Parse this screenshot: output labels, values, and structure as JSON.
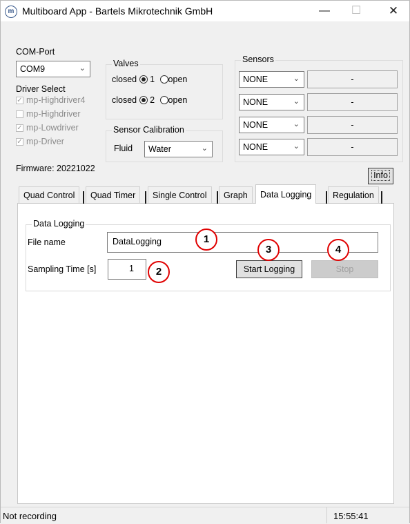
{
  "window": {
    "title": "Multiboard App - Bartels Mikrotechnik GmbH",
    "icon_letter": "m"
  },
  "titlebar": {
    "minimize": "—",
    "maximize": "☐",
    "close": "✕"
  },
  "com_port": {
    "label": "COM-Port",
    "value": "COM9"
  },
  "driver_select": {
    "label": "Driver Select",
    "items": [
      {
        "label": "mp-Highdriver4",
        "checked": true
      },
      {
        "label": "mp-Highdriver",
        "checked": false
      },
      {
        "label": "mp-Lowdriver",
        "checked": true
      },
      {
        "label": "mp-Driver",
        "checked": true
      }
    ]
  },
  "valves": {
    "label": "Valves",
    "rows": [
      {
        "closed": "closed",
        "number": "1",
        "open": "open"
      },
      {
        "closed": "closed",
        "number": "2",
        "open": "open"
      }
    ]
  },
  "sensor_calibration": {
    "label": "Sensor Calibration",
    "fluid_label": "Fluid",
    "fluid_value": "Water"
  },
  "sensors": {
    "label": "Sensors",
    "rows": [
      {
        "type": "NONE",
        "value": "-"
      },
      {
        "type": "NONE",
        "value": "-"
      },
      {
        "type": "NONE",
        "value": "-"
      },
      {
        "type": "NONE",
        "value": "-"
      }
    ]
  },
  "firmware": "Firmware: 20221022",
  "info_button": "Info",
  "tabs": [
    "Quad Control",
    "Quad Timer",
    "Single Control",
    "Graph",
    "Data Logging",
    "Regulation"
  ],
  "data_logging": {
    "group_label": "Data Logging",
    "file_name_label": "File name",
    "file_name_value": "DataLogging",
    "sampling_label": "Sampling Time [s]",
    "sampling_value": "1",
    "start_button": "Start Logging",
    "stop_button": "Stop"
  },
  "annotations": [
    "1",
    "2",
    "3",
    "4"
  ],
  "status": {
    "text": "Not recording",
    "time": "15:55:41"
  },
  "colors": {
    "annotation": "#e00000",
    "window_bg": "#f0f0f0",
    "panel_bg": "#ffffff"
  }
}
